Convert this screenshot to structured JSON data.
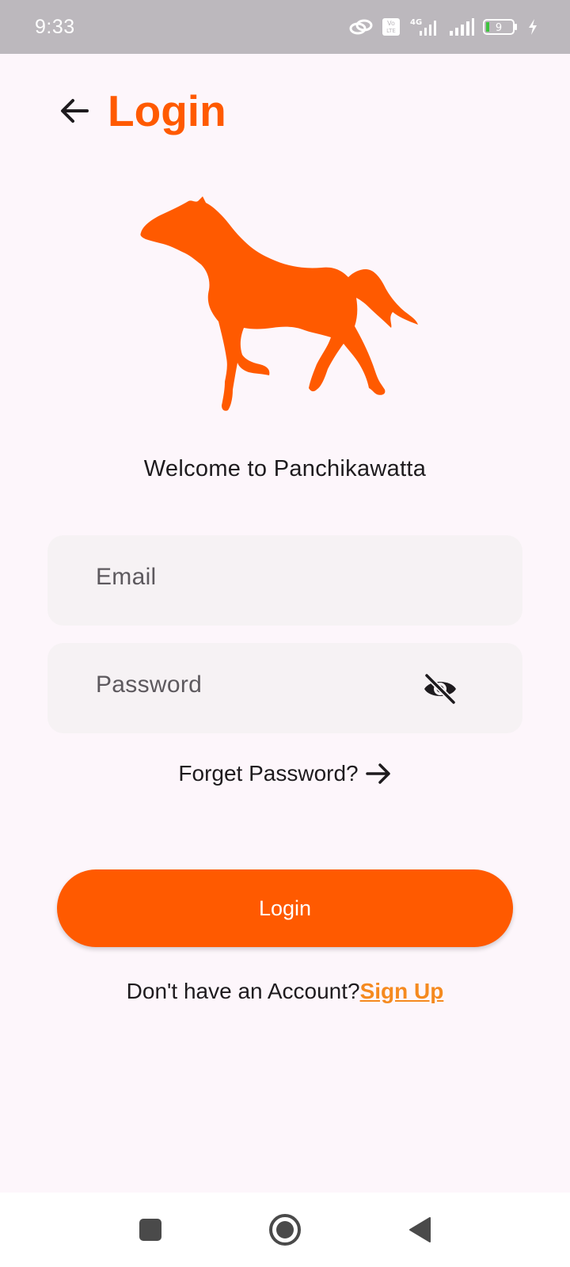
{
  "status_bar": {
    "time": "9:33",
    "network": "4G",
    "volte": "Vo LTE",
    "battery": "9"
  },
  "header": {
    "back_icon": "arrow-left-icon",
    "title": "Login"
  },
  "logo": {
    "icon": "horse-icon",
    "color": "#ff5a00"
  },
  "welcome_text": "Welcome to Panchikawatta",
  "email": {
    "placeholder": "Email",
    "value": ""
  },
  "password": {
    "placeholder": "Password",
    "value": "",
    "visibility_icon": "eye-off-icon"
  },
  "forgot": {
    "label": "Forget Password?",
    "icon": "arrow-right-icon"
  },
  "login_button": {
    "label": "Login"
  },
  "signup": {
    "prompt": "Don't have an Account?",
    "link": "Sign Up"
  },
  "colors": {
    "accent": "#ff5a00",
    "link": "#f58a1f",
    "background": "#fdf6fb"
  }
}
